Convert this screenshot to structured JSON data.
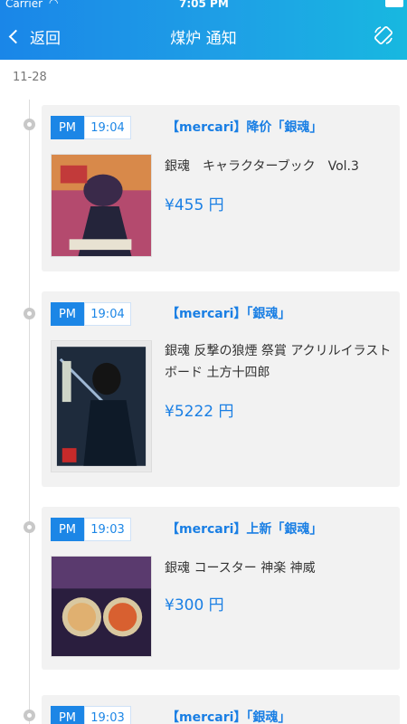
{
  "status": {
    "carrier": "Carrier",
    "time": "7:05 PM"
  },
  "nav": {
    "back_label": "返回",
    "title": "煤炉 通知"
  },
  "date": "11-28",
  "items": [
    {
      "ampm": "PM",
      "time": "19:04",
      "title": "【mercari】降价「銀魂」",
      "name": "銀魂　キャラクターブック　Vol.3",
      "price": "¥455 円"
    },
    {
      "ampm": "PM",
      "time": "19:04",
      "title": "【mercari】「銀魂」",
      "name": "銀魂 反撃の狼煙 祭賞 アクリルイラストボード 土方十四郎",
      "price": "¥5222 円"
    },
    {
      "ampm": "PM",
      "time": "19:03",
      "title": "【mercari】上新「銀魂」",
      "name": "銀魂 コースター 神楽 神威",
      "price": "¥300 円"
    },
    {
      "ampm": "PM",
      "time": "19:03",
      "title": "【mercari】「銀魂」"
    }
  ],
  "colors": {
    "accent": "#1a86e8",
    "card_bg": "#f2f2f2"
  }
}
